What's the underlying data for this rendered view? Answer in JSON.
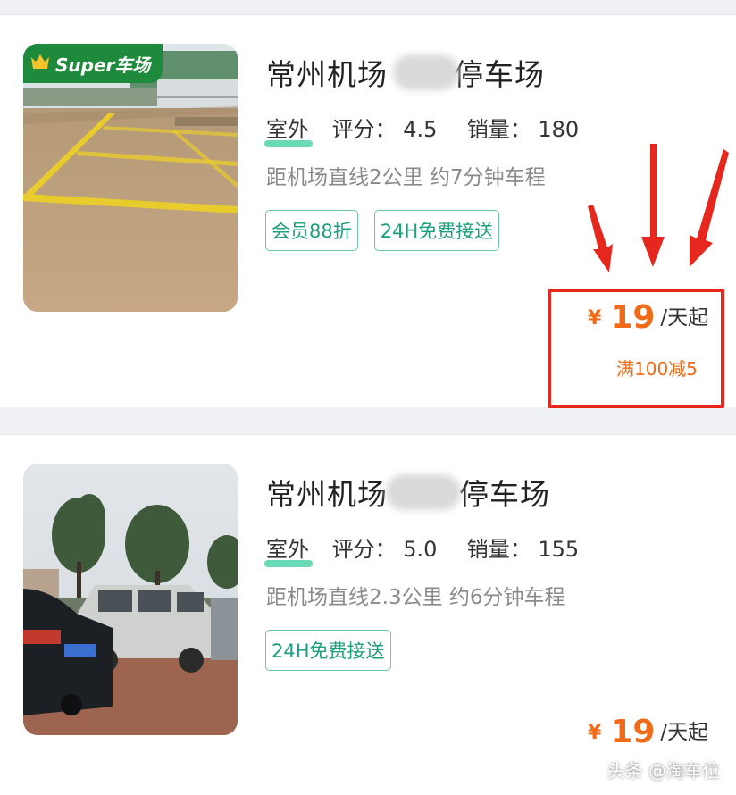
{
  "colors": {
    "accent_green": "#1ea080",
    "price_orange": "#ef6b1a",
    "annotation_red": "#e5271d",
    "badge_green": "#1d8a3c"
  },
  "listings": [
    {
      "title_prefix": "常州机场",
      "title_suffix": "停车场",
      "badge_text": "Super车场",
      "badge_icon": "crown-icon",
      "outdoor": "室外",
      "rating_label": "评分：",
      "rating": "4.5",
      "sales_label": "销量：",
      "sales": "180",
      "distance": "距机场直线2公里 约7分钟车程",
      "tags": [
        "会员88折",
        "24H免费接送"
      ],
      "price_symbol": "¥",
      "price": "19",
      "price_unit": "/天起",
      "discount": "满100减5"
    },
    {
      "title_prefix": "常州机场",
      "title_suffix": "停车场",
      "outdoor": "室外",
      "rating_label": "评分：",
      "rating": "5.0",
      "sales_label": "销量：",
      "sales": "155",
      "distance": "距机场直线2.3公里 约6分钟车程",
      "tags": [
        "24H免费接送"
      ],
      "price_symbol": "¥",
      "price": "19",
      "price_unit": "/天起"
    }
  ],
  "watermark": "头条 @淘车位"
}
